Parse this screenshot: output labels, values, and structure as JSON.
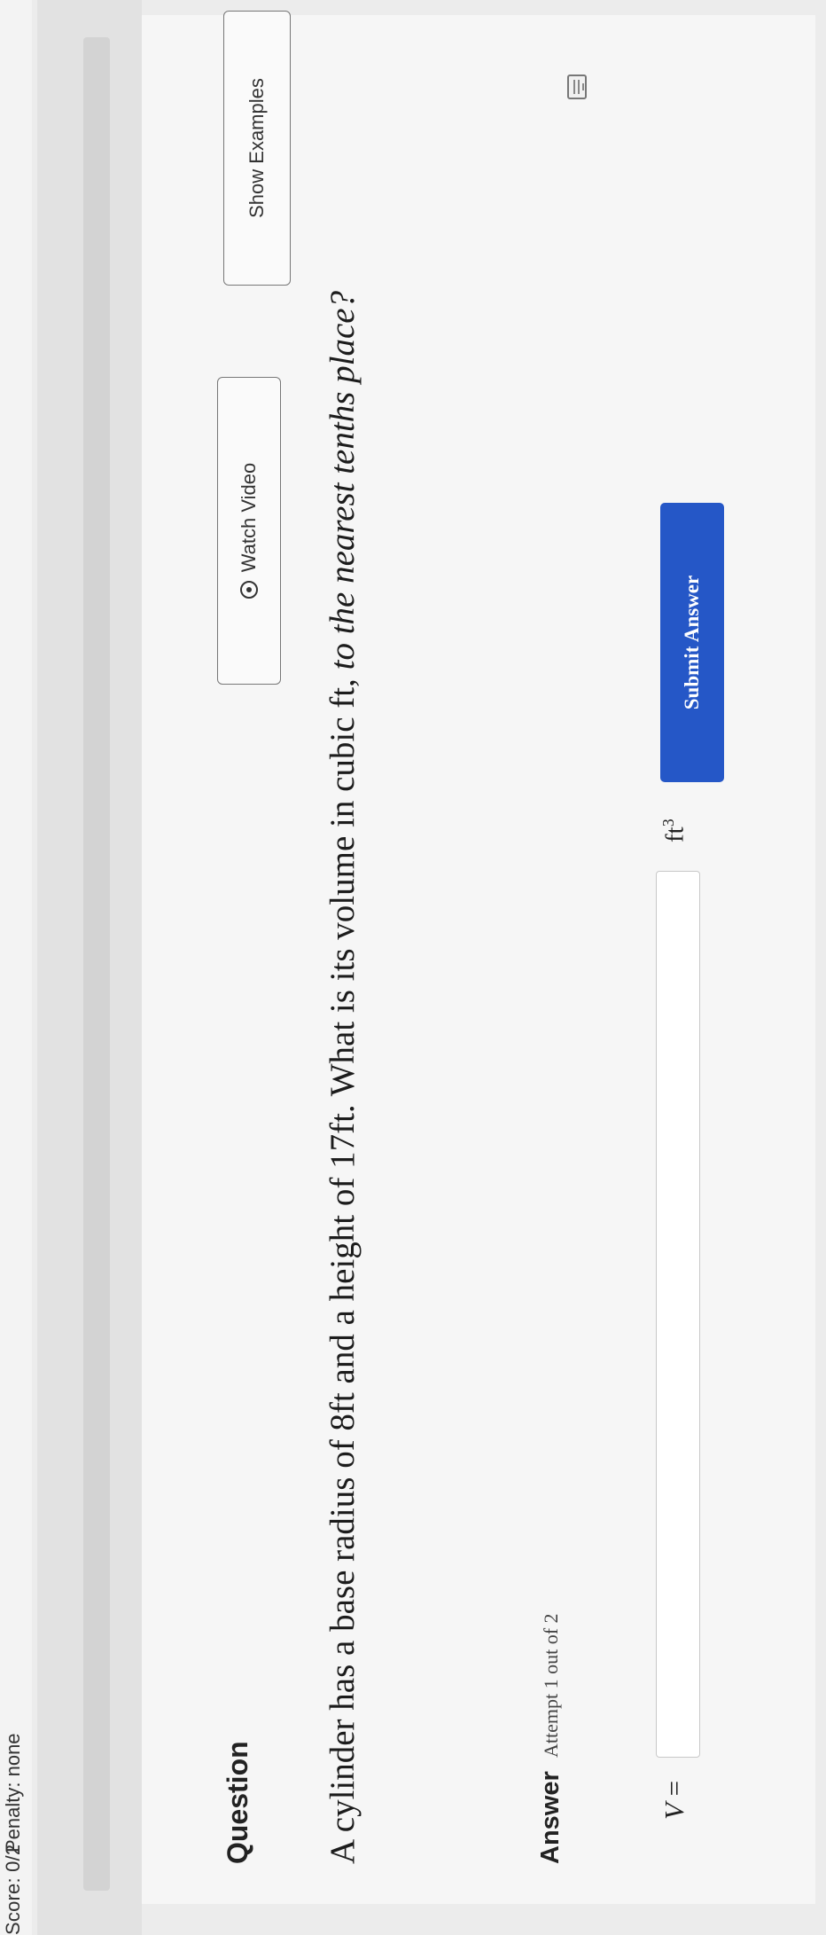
{
  "header": {
    "score": "Score: 0/2",
    "penalty": "Penalty: none"
  },
  "question": {
    "title": "Question",
    "watch_video_label": "Watch Video",
    "show_examples_label": "Show Examples",
    "text_main": "A cylinder has a base radius of 8ft and a height of 17ft. What is its volume in cubic ft, ",
    "text_emphasis": "to the nearest tenths place?"
  },
  "answer": {
    "label": "Answer",
    "attempt": "Attempt 1 out of 2",
    "variable": "V",
    "equals": "=",
    "input_value": "",
    "unit": "ft",
    "unit_exponent": "3",
    "submit_label": "Submit Answer"
  },
  "colors": {
    "submit_bg": "#2557c7",
    "page_bg": "#ececec"
  },
  "icons": [
    "play-circle-icon",
    "keyboard-icon"
  ]
}
